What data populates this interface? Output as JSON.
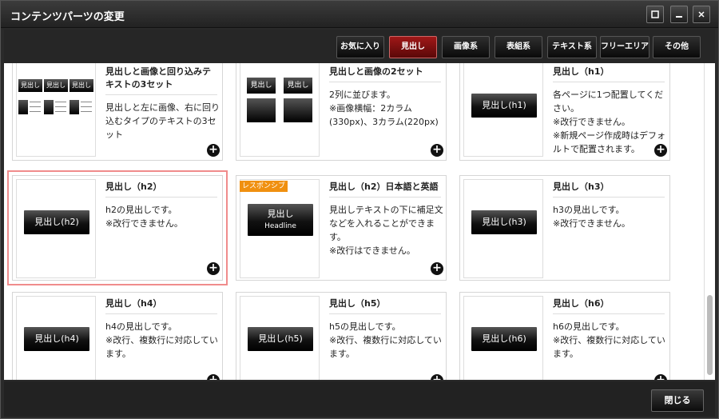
{
  "window": {
    "title": "コンテンツパーツの変更"
  },
  "window_buttons": {
    "restore": "□",
    "minimize": "—",
    "close": "✕"
  },
  "tabs": [
    {
      "label": "お気に入り",
      "active": false
    },
    {
      "label": "見出し",
      "active": true
    },
    {
      "label": "画像系",
      "active": false
    },
    {
      "label": "表組系",
      "active": false
    },
    {
      "label": "テキスト系",
      "active": false
    },
    {
      "label": "フリーエリア",
      "active": false
    },
    {
      "label": "その他",
      "active": false
    }
  ],
  "cards": [
    {
      "title": "見出しと画像と回り込みテキストの3セット",
      "desc": "見出しと左に画像、右に回り込むタイプのテキストの3セット",
      "thumb_label": "見出し"
    },
    {
      "title": "見出しと画像の2セット",
      "desc": "2列に並びます。\n※画像横幅：2カラム(330px)、3カラム(220px)",
      "thumb_label": "見出し"
    },
    {
      "title": "見出し（h1）",
      "desc": "各ページに1つ配置してください。\n※改行できません。\n※新規ページ作成時はデフォルトで配置されます。",
      "thumb_label": "見出し(h1)"
    },
    {
      "title": "見出し（h2）",
      "desc": "h2の見出しです。\n※改行できません。",
      "thumb_label": "見出し(h2)"
    },
    {
      "title": "見出し（h2）日本語と英語",
      "desc": "見出しテキストの下に補足文などを入れることができます。\n※改行はできません。",
      "thumb_label": "見出し",
      "thumb_sub": "Headline",
      "badge": "レスポンシブ"
    },
    {
      "title": "見出し（h3）",
      "desc": "h3の見出しです。\n※改行できません。",
      "thumb_label": "見出し(h3)"
    },
    {
      "title": "見出し（h4）",
      "desc": "h4の見出しです。\n※改行、複数行に対応しています。",
      "thumb_label": "見出し(h4)"
    },
    {
      "title": "見出し（h5）",
      "desc": "h5の見出しです。\n※改行、複数行に対応しています。",
      "thumb_label": "見出し(h5)"
    },
    {
      "title": "見出し（h6）",
      "desc": "h6の見出しです。\n※改行、複数行に対応しています。",
      "thumb_label": "見出し(h6)"
    }
  ],
  "add_icon": "+",
  "footer": {
    "close_label": "閉じる"
  }
}
